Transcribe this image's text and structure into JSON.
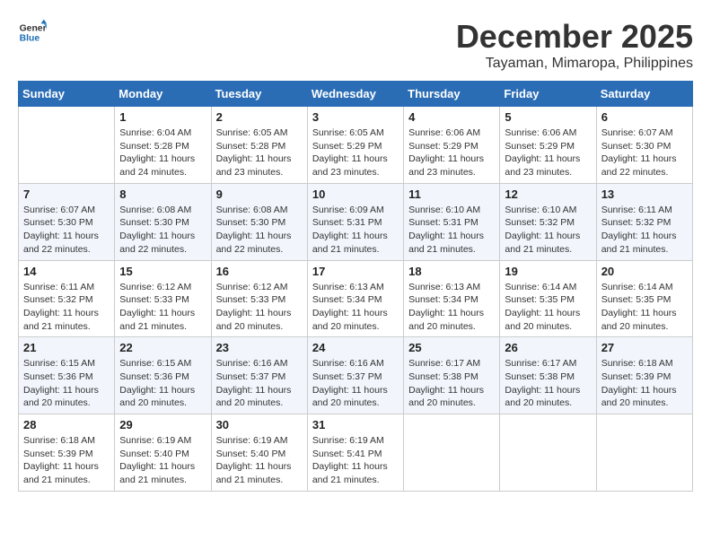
{
  "header": {
    "logo_line1": "General",
    "logo_line2": "Blue",
    "month_year": "December 2025",
    "location": "Tayaman, Mimaropa, Philippines"
  },
  "days_of_week": [
    "Sunday",
    "Monday",
    "Tuesday",
    "Wednesday",
    "Thursday",
    "Friday",
    "Saturday"
  ],
  "weeks": [
    [
      {
        "day": "",
        "sunrise": "",
        "sunset": "",
        "daylight": ""
      },
      {
        "day": "1",
        "sunrise": "Sunrise: 6:04 AM",
        "sunset": "Sunset: 5:28 PM",
        "daylight": "Daylight: 11 hours and 24 minutes."
      },
      {
        "day": "2",
        "sunrise": "Sunrise: 6:05 AM",
        "sunset": "Sunset: 5:28 PM",
        "daylight": "Daylight: 11 hours and 23 minutes."
      },
      {
        "day": "3",
        "sunrise": "Sunrise: 6:05 AM",
        "sunset": "Sunset: 5:29 PM",
        "daylight": "Daylight: 11 hours and 23 minutes."
      },
      {
        "day": "4",
        "sunrise": "Sunrise: 6:06 AM",
        "sunset": "Sunset: 5:29 PM",
        "daylight": "Daylight: 11 hours and 23 minutes."
      },
      {
        "day": "5",
        "sunrise": "Sunrise: 6:06 AM",
        "sunset": "Sunset: 5:29 PM",
        "daylight": "Daylight: 11 hours and 23 minutes."
      },
      {
        "day": "6",
        "sunrise": "Sunrise: 6:07 AM",
        "sunset": "Sunset: 5:30 PM",
        "daylight": "Daylight: 11 hours and 22 minutes."
      }
    ],
    [
      {
        "day": "7",
        "sunrise": "Sunrise: 6:07 AM",
        "sunset": "Sunset: 5:30 PM",
        "daylight": "Daylight: 11 hours and 22 minutes."
      },
      {
        "day": "8",
        "sunrise": "Sunrise: 6:08 AM",
        "sunset": "Sunset: 5:30 PM",
        "daylight": "Daylight: 11 hours and 22 minutes."
      },
      {
        "day": "9",
        "sunrise": "Sunrise: 6:08 AM",
        "sunset": "Sunset: 5:30 PM",
        "daylight": "Daylight: 11 hours and 22 minutes."
      },
      {
        "day": "10",
        "sunrise": "Sunrise: 6:09 AM",
        "sunset": "Sunset: 5:31 PM",
        "daylight": "Daylight: 11 hours and 21 minutes."
      },
      {
        "day": "11",
        "sunrise": "Sunrise: 6:10 AM",
        "sunset": "Sunset: 5:31 PM",
        "daylight": "Daylight: 11 hours and 21 minutes."
      },
      {
        "day": "12",
        "sunrise": "Sunrise: 6:10 AM",
        "sunset": "Sunset: 5:32 PM",
        "daylight": "Daylight: 11 hours and 21 minutes."
      },
      {
        "day": "13",
        "sunrise": "Sunrise: 6:11 AM",
        "sunset": "Sunset: 5:32 PM",
        "daylight": "Daylight: 11 hours and 21 minutes."
      }
    ],
    [
      {
        "day": "14",
        "sunrise": "Sunrise: 6:11 AM",
        "sunset": "Sunset: 5:32 PM",
        "daylight": "Daylight: 11 hours and 21 minutes."
      },
      {
        "day": "15",
        "sunrise": "Sunrise: 6:12 AM",
        "sunset": "Sunset: 5:33 PM",
        "daylight": "Daylight: 11 hours and 21 minutes."
      },
      {
        "day": "16",
        "sunrise": "Sunrise: 6:12 AM",
        "sunset": "Sunset: 5:33 PM",
        "daylight": "Daylight: 11 hours and 20 minutes."
      },
      {
        "day": "17",
        "sunrise": "Sunrise: 6:13 AM",
        "sunset": "Sunset: 5:34 PM",
        "daylight": "Daylight: 11 hours and 20 minutes."
      },
      {
        "day": "18",
        "sunrise": "Sunrise: 6:13 AM",
        "sunset": "Sunset: 5:34 PM",
        "daylight": "Daylight: 11 hours and 20 minutes."
      },
      {
        "day": "19",
        "sunrise": "Sunrise: 6:14 AM",
        "sunset": "Sunset: 5:35 PM",
        "daylight": "Daylight: 11 hours and 20 minutes."
      },
      {
        "day": "20",
        "sunrise": "Sunrise: 6:14 AM",
        "sunset": "Sunset: 5:35 PM",
        "daylight": "Daylight: 11 hours and 20 minutes."
      }
    ],
    [
      {
        "day": "21",
        "sunrise": "Sunrise: 6:15 AM",
        "sunset": "Sunset: 5:36 PM",
        "daylight": "Daylight: 11 hours and 20 minutes."
      },
      {
        "day": "22",
        "sunrise": "Sunrise: 6:15 AM",
        "sunset": "Sunset: 5:36 PM",
        "daylight": "Daylight: 11 hours and 20 minutes."
      },
      {
        "day": "23",
        "sunrise": "Sunrise: 6:16 AM",
        "sunset": "Sunset: 5:37 PM",
        "daylight": "Daylight: 11 hours and 20 minutes."
      },
      {
        "day": "24",
        "sunrise": "Sunrise: 6:16 AM",
        "sunset": "Sunset: 5:37 PM",
        "daylight": "Daylight: 11 hours and 20 minutes."
      },
      {
        "day": "25",
        "sunrise": "Sunrise: 6:17 AM",
        "sunset": "Sunset: 5:38 PM",
        "daylight": "Daylight: 11 hours and 20 minutes."
      },
      {
        "day": "26",
        "sunrise": "Sunrise: 6:17 AM",
        "sunset": "Sunset: 5:38 PM",
        "daylight": "Daylight: 11 hours and 20 minutes."
      },
      {
        "day": "27",
        "sunrise": "Sunrise: 6:18 AM",
        "sunset": "Sunset: 5:39 PM",
        "daylight": "Daylight: 11 hours and 20 minutes."
      }
    ],
    [
      {
        "day": "28",
        "sunrise": "Sunrise: 6:18 AM",
        "sunset": "Sunset: 5:39 PM",
        "daylight": "Daylight: 11 hours and 21 minutes."
      },
      {
        "day": "29",
        "sunrise": "Sunrise: 6:19 AM",
        "sunset": "Sunset: 5:40 PM",
        "daylight": "Daylight: 11 hours and 21 minutes."
      },
      {
        "day": "30",
        "sunrise": "Sunrise: 6:19 AM",
        "sunset": "Sunset: 5:40 PM",
        "daylight": "Daylight: 11 hours and 21 minutes."
      },
      {
        "day": "31",
        "sunrise": "Sunrise: 6:19 AM",
        "sunset": "Sunset: 5:41 PM",
        "daylight": "Daylight: 11 hours and 21 minutes."
      },
      {
        "day": "",
        "sunrise": "",
        "sunset": "",
        "daylight": ""
      },
      {
        "day": "",
        "sunrise": "",
        "sunset": "",
        "daylight": ""
      },
      {
        "day": "",
        "sunrise": "",
        "sunset": "",
        "daylight": ""
      }
    ]
  ]
}
